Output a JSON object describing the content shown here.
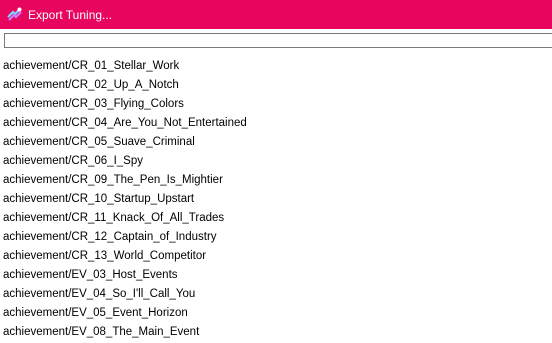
{
  "window": {
    "title": "Export Tuning...",
    "icon": "export-tuning-app-icon",
    "titlebar_color": "#e8055e"
  },
  "search": {
    "value": "",
    "placeholder": ""
  },
  "list": {
    "items": [
      "achievement/CR_01_Stellar_Work",
      "achievement/CR_02_Up_A_Notch",
      "achievement/CR_03_Flying_Colors",
      "achievement/CR_04_Are_You_Not_Entertained",
      "achievement/CR_05_Suave_Criminal",
      "achievement/CR_06_I_Spy",
      "achievement/CR_09_The_Pen_Is_Mightier",
      "achievement/CR_10_Startup_Upstart",
      "achievement/CR_11_Knack_Of_All_Trades",
      "achievement/CR_12_Captain_of_Industry",
      "achievement/CR_13_World_Competitor",
      "achievement/EV_03_Host_Events",
      "achievement/EV_04_So_I'll_Call_You",
      "achievement/EV_05_Event_Horizon",
      "achievement/EV_08_The_Main_Event"
    ]
  }
}
